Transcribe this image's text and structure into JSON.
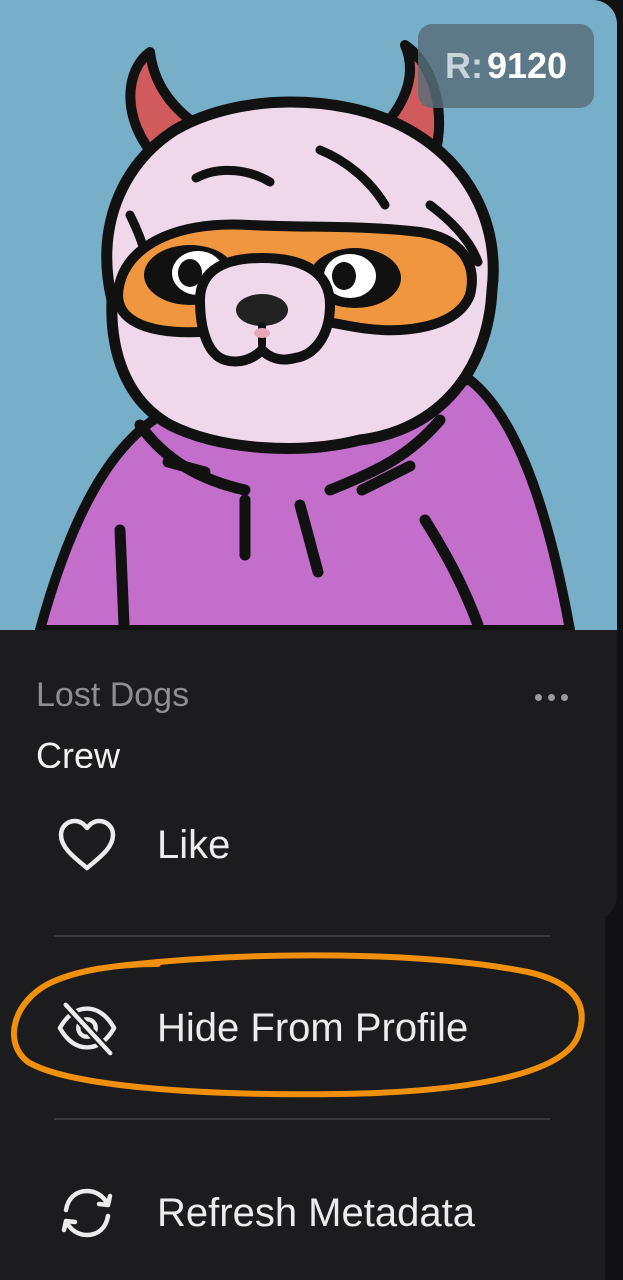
{
  "nft": {
    "rarity_prefix": "R:",
    "rarity_value": "9120",
    "collection": "Lost Dogs",
    "name": "Crew"
  },
  "menu": {
    "items": [
      {
        "label": "Like",
        "icon": "heart-icon"
      },
      {
        "label": "Hide From Profile",
        "icon": "eye-off-icon"
      },
      {
        "label": "Refresh Metadata",
        "icon": "refresh-icon"
      }
    ]
  },
  "colors": {
    "image_background": "#77aec8",
    "card_background": "#1c1c1e",
    "annotation": "#f0900c",
    "hoodie": "#c36ecb",
    "mask": "#f0963e",
    "horns": "#d05a5c"
  }
}
